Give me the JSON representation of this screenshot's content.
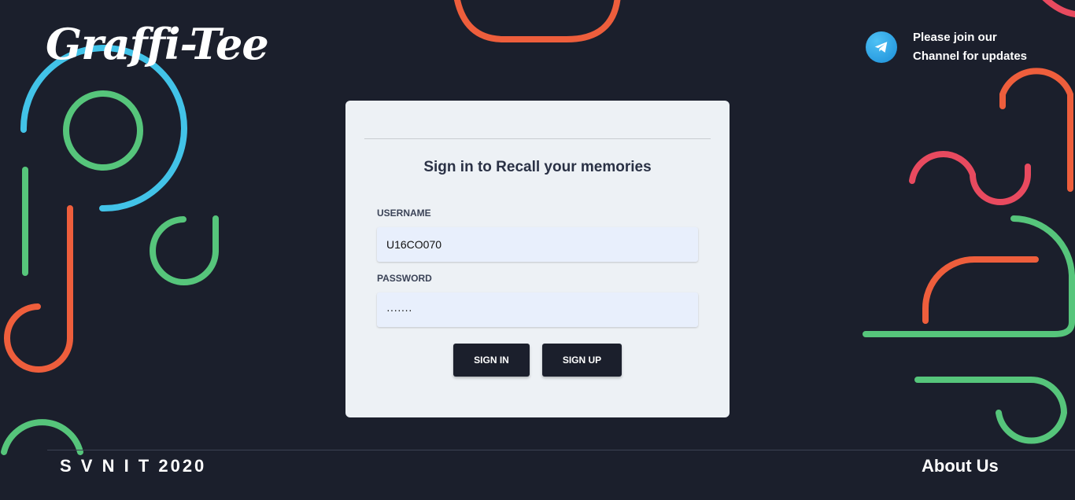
{
  "brand": {
    "logo_text": "Graffi-Tee"
  },
  "telegram": {
    "text": "Please join our Channel for updates",
    "icon": "telegram-icon",
    "color": "#2aa3e6"
  },
  "login": {
    "title": "Sign in to Recall your memories",
    "username_label": "USERNAME",
    "username_value": "U16CO070",
    "password_label": "PASSWORD",
    "password_value": "·······",
    "signin_label": "SIGN IN",
    "signup_label": "SIGN UP"
  },
  "footer": {
    "left_text": "S V N I T 2020",
    "right_link": "About Us"
  },
  "colors": {
    "background": "#1b1f2c",
    "card": "#edf1f5",
    "accent_orange": "#ee5e3c",
    "accent_green": "#56c57b",
    "accent_blue": "#42c3e8",
    "accent_red": "#e84a5f"
  }
}
